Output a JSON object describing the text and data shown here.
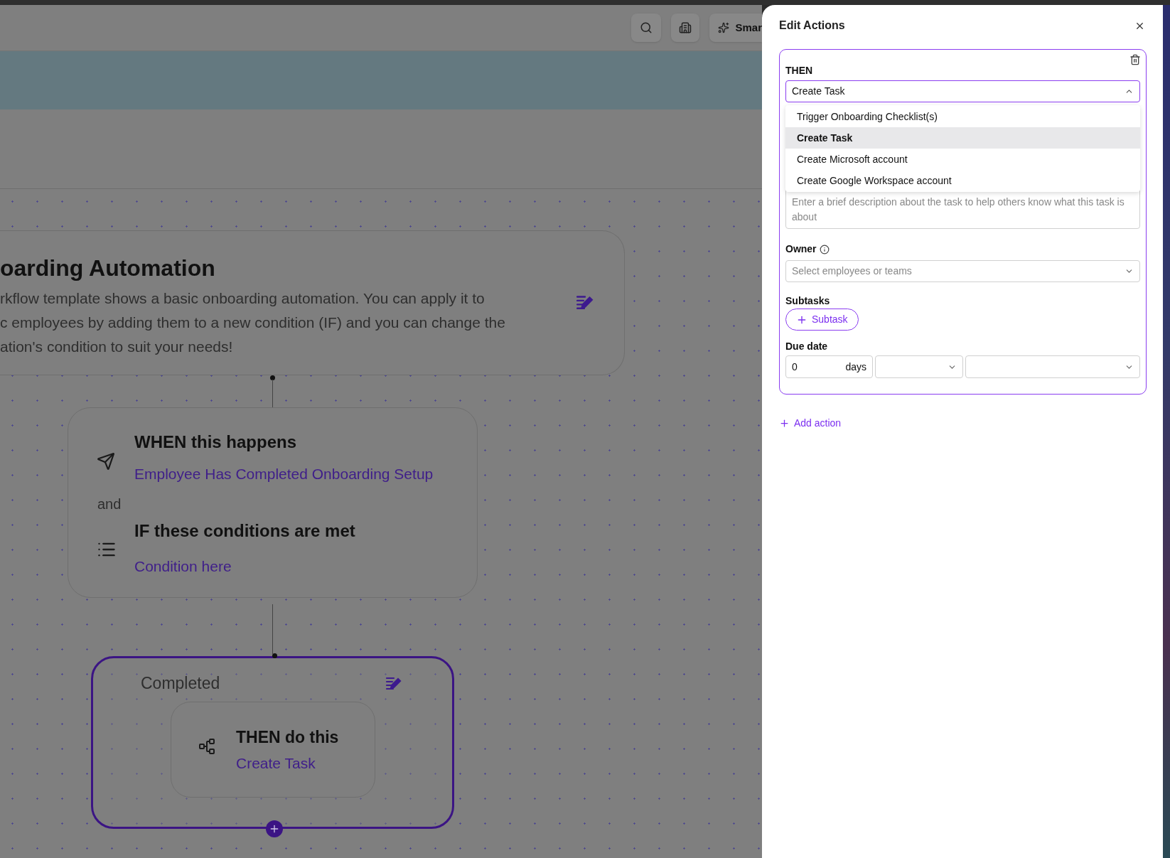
{
  "toolbar": {
    "buttons": [
      {
        "kind": "search"
      },
      {
        "kind": "building"
      },
      {
        "kind": "smart",
        "label": "Smar"
      }
    ]
  },
  "workflow": {
    "title": "oarding Automation",
    "description_lines": [
      "rkflow template shows a basic onboarding automation. You can apply it to",
      "c employees by adding them to a new condition (IF) and you can change the",
      "ation's condition to suit your needs!"
    ]
  },
  "trigger": {
    "when_heading": "WHEN this happens",
    "event": "Employee Has Completed Onboarding Setup",
    "joiner": "and",
    "if_heading": "IF these conditions are met",
    "condition": "Condition here"
  },
  "branch": {
    "label": "Completed",
    "action_heading": "THEN do this",
    "action": "Create Task"
  },
  "panel": {
    "title": "Edit Actions",
    "action_card": {
      "then_label": "THEN",
      "select_value": "Create Task",
      "expanded": true,
      "options": [
        {
          "label": "Trigger Onboarding Checklist(s)",
          "selected": false
        },
        {
          "label": "Create Task",
          "selected": true
        },
        {
          "label": "Create Microsoft account",
          "selected": false
        },
        {
          "label": "Create Google Workspace account",
          "selected": false
        }
      ],
      "description_placeholder": "Enter a brief description about the task to help others know what this task is about",
      "owner_label": "Owner",
      "owner_placeholder": "Select employees or teams",
      "subtasks_label": "Subtasks",
      "subtask_button": "Subtask",
      "due_date_label": "Due date",
      "due_value": "0",
      "due_unit": "days"
    },
    "add_action": "Add action"
  }
}
